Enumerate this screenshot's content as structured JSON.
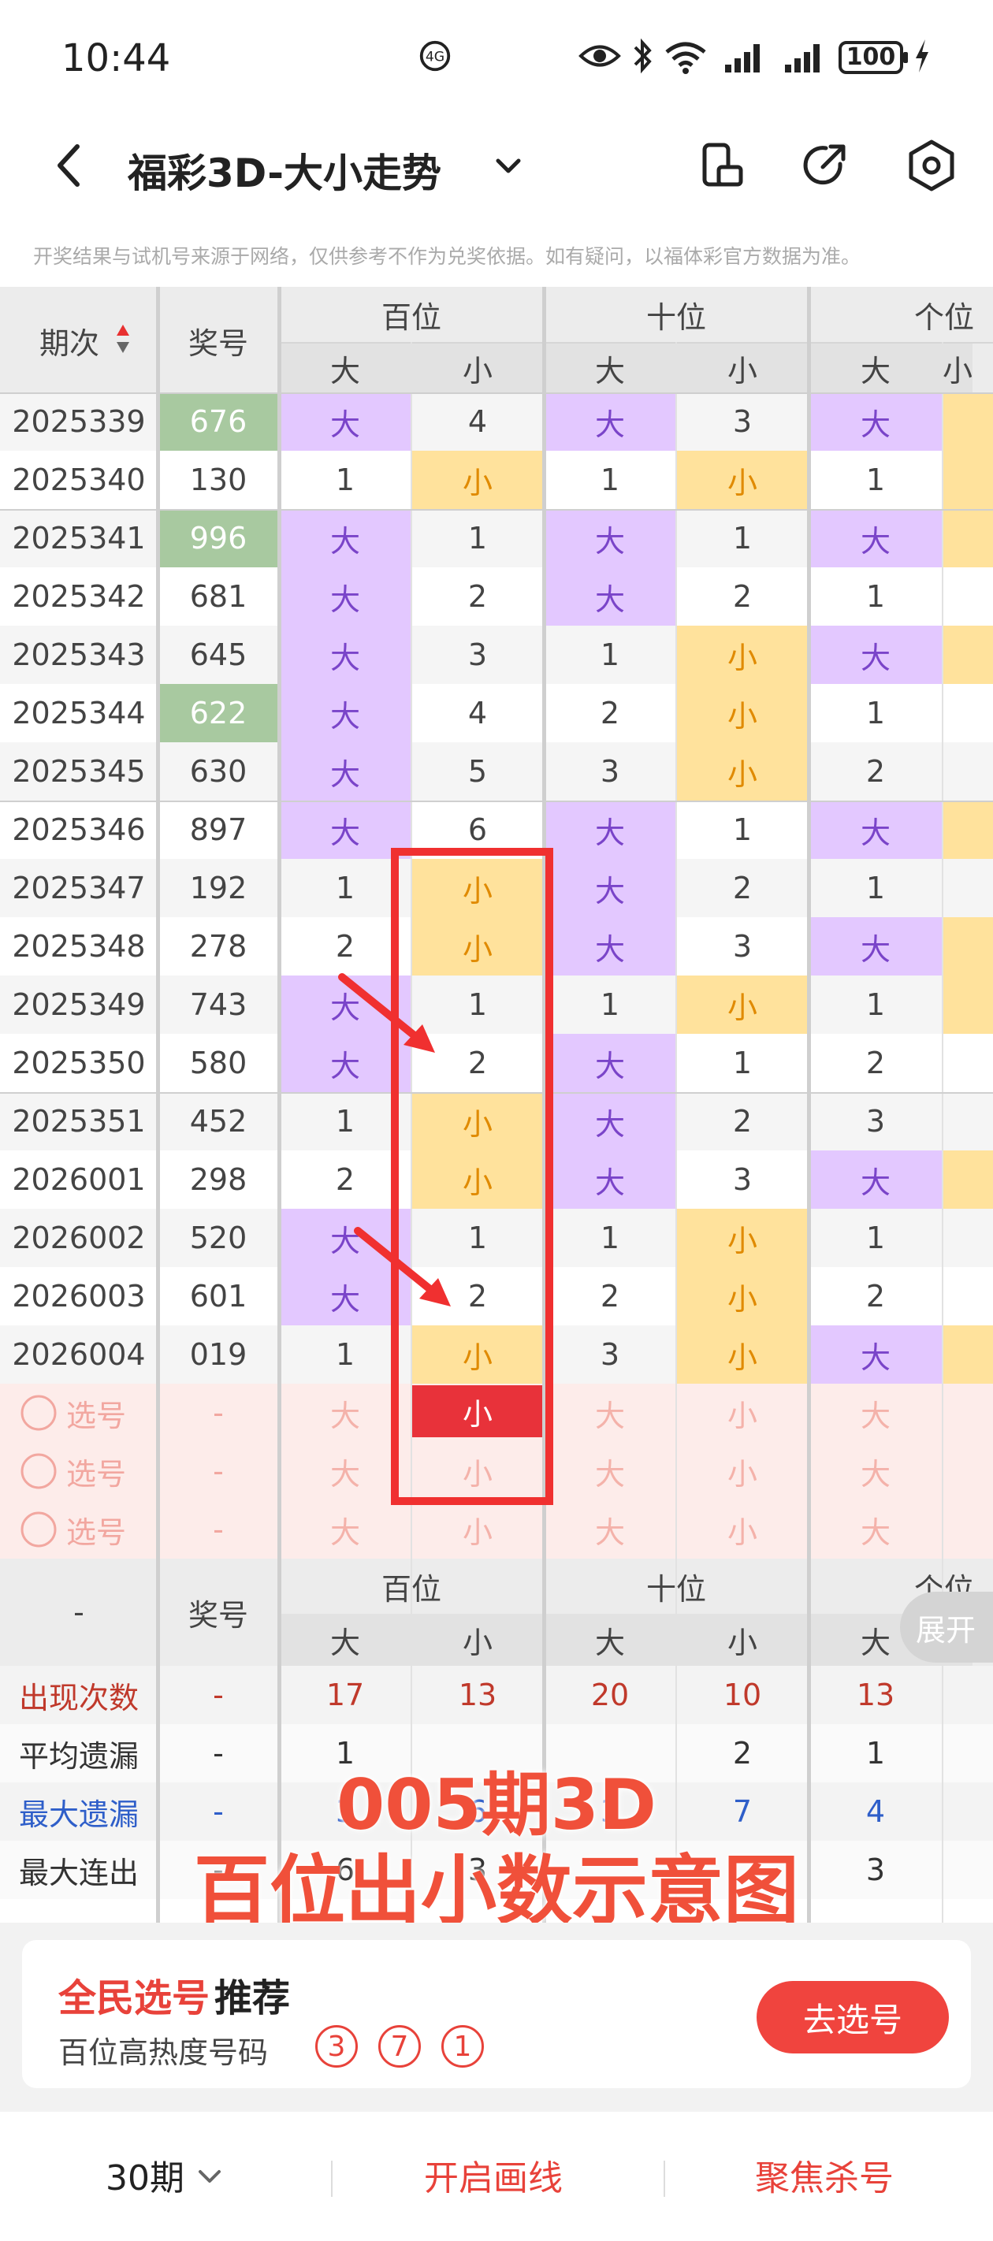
{
  "status_bar": {
    "time": "10:44",
    "battery": "100"
  },
  "header": {
    "title": "福彩3D-大小走势"
  },
  "disclaimer": "开奖结果与试机号来源于网络，仅供参考不作为兑奖依据。如有疑问，以福体彩官方数据为准。",
  "table": {
    "col_period": "期次",
    "col_number": "奖号",
    "groups": [
      "百位",
      "十位",
      "个位"
    ],
    "big": "大",
    "small": "小",
    "rows": [
      {
        "period": "2025339",
        "number": "676",
        "hl": true,
        "cells": [
          "B",
          "4",
          "B",
          "3",
          "B"
        ]
      },
      {
        "period": "2025340",
        "number": "130",
        "hl": false,
        "cells": [
          "1",
          "S",
          "1",
          "S",
          "1"
        ]
      },
      {
        "period": "2025341",
        "number": "996",
        "hl": true,
        "cells": [
          "B",
          "1",
          "B",
          "1",
          "B"
        ]
      },
      {
        "period": "2025342",
        "number": "681",
        "hl": false,
        "cells": [
          "B",
          "2",
          "B",
          "2",
          "1"
        ]
      },
      {
        "period": "2025343",
        "number": "645",
        "hl": false,
        "cells": [
          "B",
          "3",
          "1",
          "S",
          "B"
        ]
      },
      {
        "period": "2025344",
        "number": "622",
        "hl": true,
        "cells": [
          "B",
          "4",
          "2",
          "S",
          "1"
        ]
      },
      {
        "period": "2025345",
        "number": "630",
        "hl": false,
        "cells": [
          "B",
          "5",
          "3",
          "S",
          "2"
        ]
      },
      {
        "period": "2025346",
        "number": "897",
        "hl": false,
        "cells": [
          "B",
          "6",
          "B",
          "1",
          "B"
        ]
      },
      {
        "period": "2025347",
        "number": "192",
        "hl": false,
        "cells": [
          "1",
          "S",
          "B",
          "2",
          "1"
        ]
      },
      {
        "period": "2025348",
        "number": "278",
        "hl": false,
        "cells": [
          "2",
          "S",
          "B",
          "3",
          "B"
        ]
      },
      {
        "period": "2025349",
        "number": "743",
        "hl": false,
        "cells": [
          "B",
          "1",
          "1",
          "S",
          "1"
        ]
      },
      {
        "period": "2025350",
        "number": "580",
        "hl": false,
        "cells": [
          "B",
          "2",
          "B",
          "1",
          "2"
        ]
      },
      {
        "period": "2025351",
        "number": "452",
        "hl": false,
        "cells": [
          "1",
          "S",
          "B",
          "2",
          "3"
        ]
      },
      {
        "period": "2026001",
        "number": "298",
        "hl": false,
        "cells": [
          "2",
          "S",
          "B",
          "3",
          "B"
        ]
      },
      {
        "period": "2026002",
        "number": "520",
        "hl": false,
        "cells": [
          "B",
          "1",
          "1",
          "S",
          "1"
        ]
      },
      {
        "period": "2026003",
        "number": "601",
        "hl": false,
        "cells": [
          "B",
          "2",
          "2",
          "S",
          "2"
        ]
      },
      {
        "period": "2026004",
        "number": "019",
        "hl": false,
        "cells": [
          "1",
          "S",
          "3",
          "S",
          "B"
        ]
      }
    ],
    "pick_label": "选号",
    "pick_dash": "-",
    "pick_rows_count": 3,
    "stats_dash": "-",
    "stats_number": "奖号",
    "stats_rows": [
      {
        "label": "出现次数",
        "first": "-",
        "values": [
          "17",
          "13",
          "20",
          "10",
          "13"
        ],
        "style": "red"
      },
      {
        "label": "平均遗漏",
        "first": "-",
        "values": [
          "1",
          "",
          "",
          "2",
          "1"
        ],
        "style": "dark"
      },
      {
        "label": "最大遗漏",
        "first": "-",
        "values": [
          "3",
          "6",
          "3",
          "7",
          "4"
        ],
        "style": "blue"
      },
      {
        "label": "最大连出",
        "first": "-",
        "values": [
          "6",
          "3",
          "",
          "",
          "3"
        ],
        "style": "dark"
      }
    ]
  },
  "expand_label": "展开",
  "overlay": {
    "line1": "005期3D",
    "line2": "百位出小数示意图"
  },
  "recommend": {
    "title_a": "全民选号",
    "title_b": "推荐",
    "subtitle": "百位高热度号码",
    "balls": [
      "3",
      "7",
      "1"
    ],
    "button": "去选号"
  },
  "bottom_bar": {
    "periods": "30期",
    "draw_lines": "开启画线",
    "focus_kill": "聚焦杀号"
  },
  "colors": {
    "accent": "#f0443e",
    "big": "#e3c8ff",
    "small": "#ffe29c",
    "hot_number": "#a8c9a0"
  }
}
